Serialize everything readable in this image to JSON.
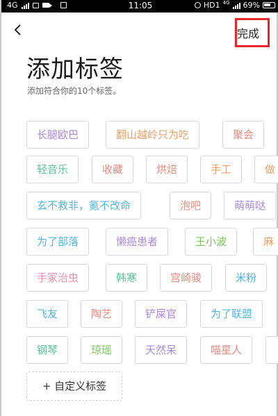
{
  "status_bar": {
    "network": "4G",
    "time": "11:05",
    "hd": "HD1",
    "net_small": "4G",
    "battery_pct": "69%"
  },
  "nav": {
    "done_label": "完成"
  },
  "header": {
    "title": "添加标签",
    "subtitle": "添加符合你的10个标签。"
  },
  "tags": [
    {
      "label": "长腿欧巴",
      "color": "#a98ad6"
    },
    {
      "label": "翻山越岭只为吃",
      "color": "#e8a06a"
    },
    {
      "label": "聚会",
      "color": "#e58a7e"
    },
    {
      "label": "轻音乐",
      "color": "#5fc29a"
    },
    {
      "label": "收藏",
      "color": "#e58a7e"
    },
    {
      "label": "烘焙",
      "color": "#e58a7e"
    },
    {
      "label": "手工",
      "color": "#e8a06a"
    },
    {
      "label": "做",
      "color": "#e8a06a"
    },
    {
      "label": "玄不救非，氪不改命",
      "color": "#4fb6d9"
    },
    {
      "label": "泡吧",
      "color": "#e58a7e"
    },
    {
      "label": "萌萌哒",
      "color": "#a98ad6"
    },
    {
      "label": "为了部落",
      "color": "#4fb6d9"
    },
    {
      "label": "懒癌患者",
      "color": "#a98ad6"
    },
    {
      "label": "王小波",
      "color": "#7cc45a"
    },
    {
      "label": "麻",
      "color": "#e8a06a"
    },
    {
      "label": "手冢治虫",
      "color": "#ee8fae"
    },
    {
      "label": "韩寒",
      "color": "#5fc29a"
    },
    {
      "label": "宫崎骏",
      "color": "#e58a7e"
    },
    {
      "label": "米粉",
      "color": "#4fb6d9"
    },
    {
      "label": "飞友",
      "color": "#4fb6d9"
    },
    {
      "label": "陶艺",
      "color": "#e58a7e"
    },
    {
      "label": "铲屎官",
      "color": "#a98ad6"
    },
    {
      "label": "为了联盟",
      "color": "#4fb6d9"
    },
    {
      "label": "钢琴",
      "color": "#5fc29a"
    },
    {
      "label": "琼瑶",
      "color": "#7cc45a"
    },
    {
      "label": "天然呆",
      "color": "#a98ad6"
    },
    {
      "label": "喵星人",
      "color": "#e58a7e"
    },
    {
      "label": "",
      "color": "#e8a06a"
    }
  ],
  "add_tag_label": "+ 自定义标签"
}
